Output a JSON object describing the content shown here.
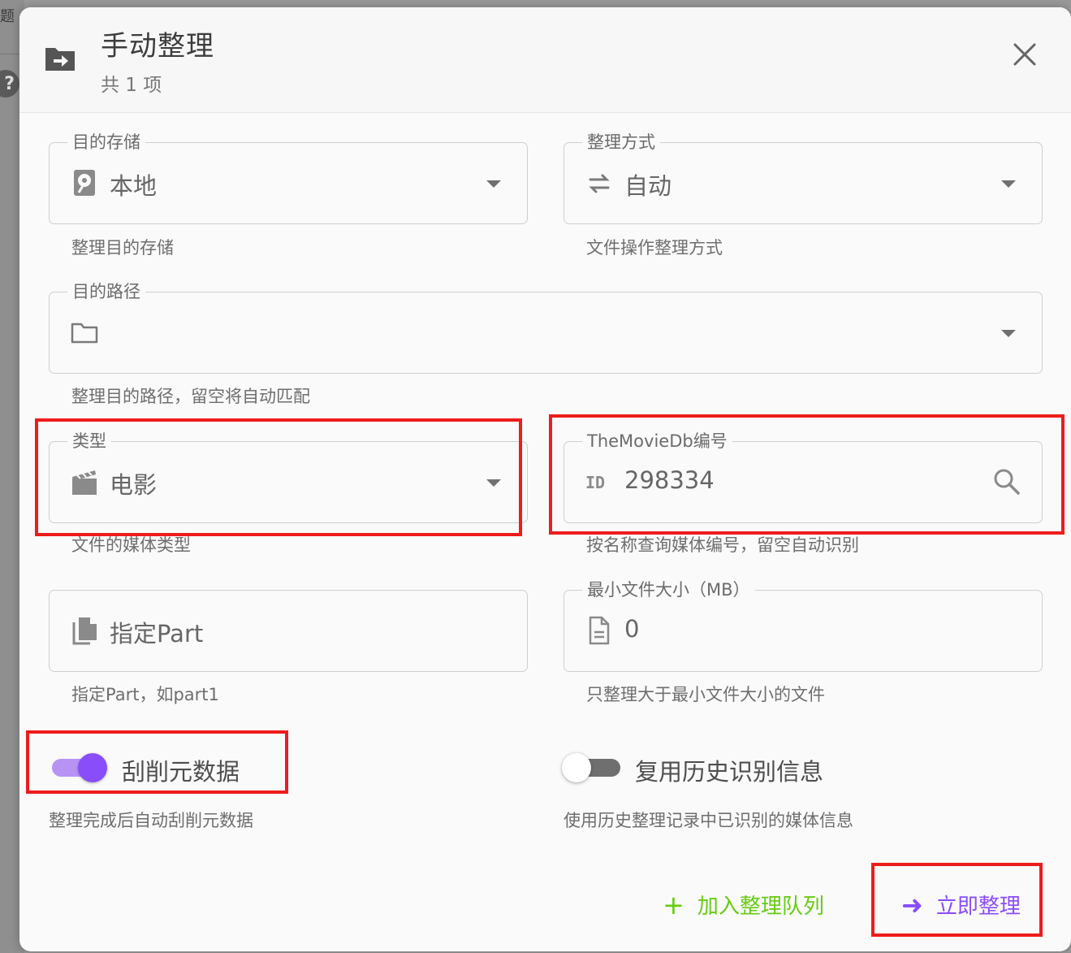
{
  "backdrop": {
    "title_fragment": "题",
    "help_glyph": "?"
  },
  "dialog": {
    "title": "手动整理",
    "subtitle": "共 1 项"
  },
  "fields": {
    "storage": {
      "label": "目的存储",
      "value": "本地",
      "hint": "整理目的存储",
      "icon": "harddisk-icon"
    },
    "transfer_mode": {
      "label": "整理方式",
      "value": "自动",
      "hint": "文件操作整理方式",
      "icon": "swap-arrows-icon"
    },
    "target_path": {
      "label": "目的路径",
      "value": "",
      "hint": "整理目的路径，留空将自动匹配",
      "icon": "folder-icon"
    },
    "media_type": {
      "label": "类型",
      "value": "电影",
      "hint": "文件的媒体类型",
      "icon": "clapperboard-icon"
    },
    "tmdb_id": {
      "label": "TheMovieDb编号",
      "value": "298334",
      "hint": "按名称查询媒体编号，留空自动识别",
      "icon": "id-icon",
      "prefix": "ID"
    },
    "part": {
      "label": "",
      "placeholder": "指定Part",
      "value": "",
      "hint": "指定Part，如part1",
      "icon": "file-copy-icon"
    },
    "min_filesize": {
      "label": "最小文件大小（MB）",
      "value": "0",
      "hint": "只整理大于最小文件大小的文件",
      "icon": "file-document-icon"
    }
  },
  "switches": {
    "scrape": {
      "label": "刮削元数据",
      "hint": "整理完成后自动刮削元数据",
      "checked": true
    },
    "reuse_history": {
      "label": "复用历史识别信息",
      "hint": "使用历史整理记录中已识别的媒体信息",
      "checked": false
    }
  },
  "actions": {
    "add_queue": {
      "label": "加入整理队列",
      "icon": "+",
      "color": "#66cc11"
    },
    "transfer_now": {
      "label": "立即整理",
      "icon": "➜",
      "color": "#8a4dfa"
    }
  },
  "colors": {
    "accent": "#8a4dfa",
    "success": "#66cc11",
    "highlight": "#ee1c1c"
  }
}
